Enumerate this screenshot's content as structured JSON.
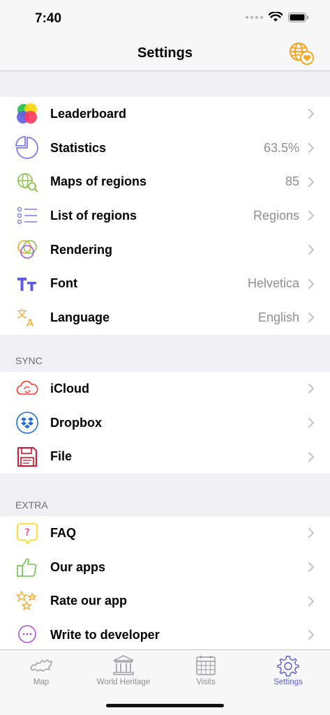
{
  "status_bar": {
    "time": "7:40"
  },
  "nav": {
    "title": "Settings",
    "action_icon": "globe-heart-icon"
  },
  "sections": {
    "main": [
      {
        "label": "Leaderboard",
        "value": "",
        "icon": "leaderboard-icon"
      },
      {
        "label": "Statistics",
        "value": "63.5%",
        "icon": "pie-chart-icon"
      },
      {
        "label": "Maps of regions",
        "value": "85",
        "icon": "globe-search-icon"
      },
      {
        "label": "List of regions",
        "value": "Regions",
        "icon": "list-icon"
      },
      {
        "label": "Rendering",
        "value": "",
        "icon": "rendering-circles-icon"
      },
      {
        "label": "Font",
        "value": "Helvetica",
        "icon": "font-icon"
      },
      {
        "label": "Language",
        "value": "English",
        "icon": "language-icon"
      }
    ],
    "sync_header": "SYNC",
    "sync": [
      {
        "label": "iCloud",
        "icon": "icloud-icon"
      },
      {
        "label": "Dropbox",
        "icon": "dropbox-icon"
      },
      {
        "label": "File",
        "icon": "floppy-disk-icon"
      }
    ],
    "extra_header": "EXTRA",
    "extra": [
      {
        "label": "FAQ",
        "icon": "faq-icon"
      },
      {
        "label": "Our apps",
        "icon": "thumbs-up-icon"
      },
      {
        "label": "Rate our app",
        "icon": "stars-icon"
      },
      {
        "label": "Write to developer",
        "icon": "chat-bubble-icon"
      }
    ]
  },
  "tabs": [
    {
      "label": "Map",
      "icon": "russia-map-icon",
      "active": false
    },
    {
      "label": "World Heritage",
      "icon": "museum-icon",
      "active": false
    },
    {
      "label": "Visits",
      "icon": "calendar-icon",
      "active": false
    },
    {
      "label": "Settings",
      "icon": "gear-icon",
      "active": true
    }
  ],
  "colors": {
    "accent": "#5b5bd6",
    "orange": "#f5a623",
    "background": "#efeff4"
  }
}
